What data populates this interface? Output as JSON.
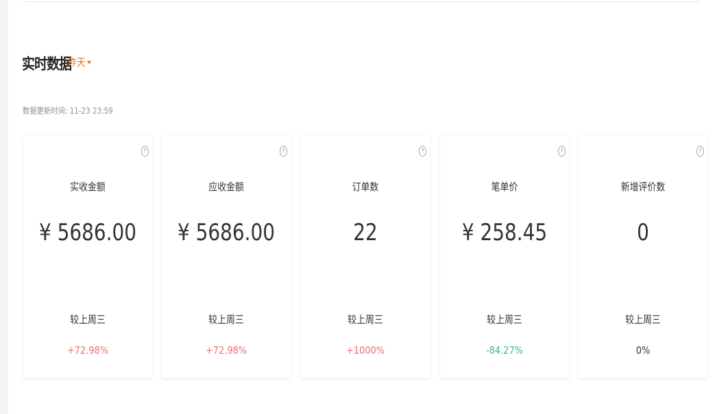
{
  "section": {
    "title": "实时数据",
    "period": "昨天",
    "update_label": "数据更新时间",
    "update_time": "11-23 23:59"
  },
  "colors": {
    "accent": "#f06a1e",
    "up": "#f26d6d",
    "down": "#3cb6a5",
    "neutral": "#333333"
  },
  "cards": [
    {
      "label": "实收金额",
      "value": "¥ 5686.00",
      "compare_label": "较上周三",
      "compare_value": "+72.98%",
      "trend": "up"
    },
    {
      "label": "应收金额",
      "value": "¥ 5686.00",
      "compare_label": "较上周三",
      "compare_value": "+72.98%",
      "trend": "up"
    },
    {
      "label": "订单数",
      "value": "22",
      "compare_label": "较上周三",
      "compare_value": "+1000%",
      "trend": "up"
    },
    {
      "label": "笔单价",
      "value": "¥ 258.45",
      "compare_label": "较上周三",
      "compare_value": "-84.27%",
      "trend": "down"
    },
    {
      "label": "新增评价数",
      "value": "0",
      "compare_label": "较上周三",
      "compare_value": "0%",
      "trend": "neutral"
    }
  ],
  "help_icon": "question-circle-icon"
}
